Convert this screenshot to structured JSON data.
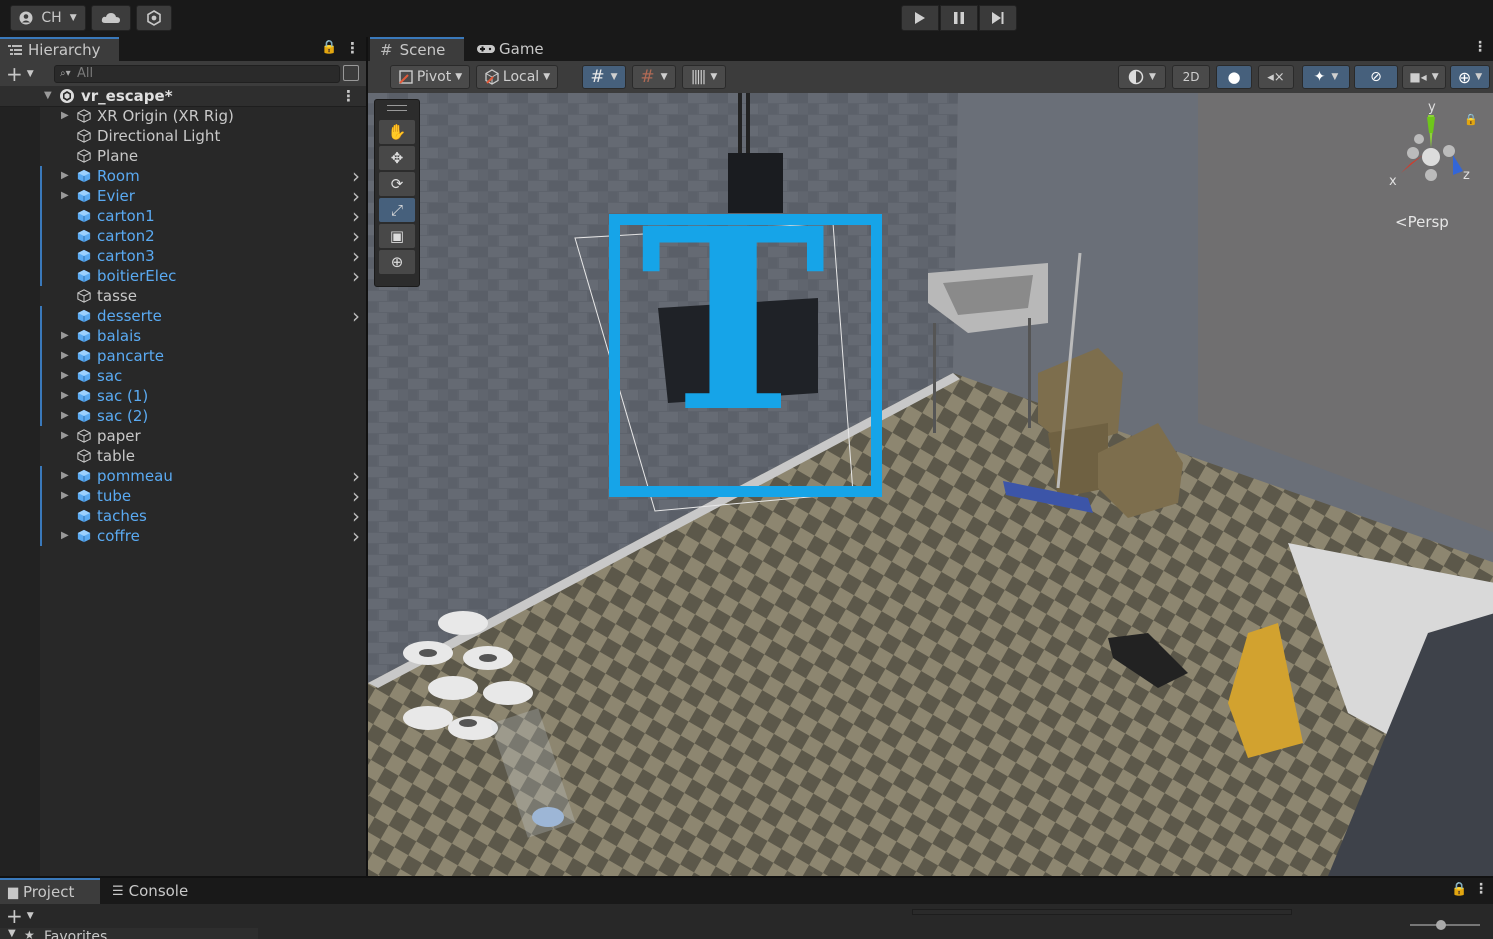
{
  "topbar": {
    "account_label": "CH",
    "icons": [
      "account-icon",
      "cloud-icon",
      "collab-icon"
    ],
    "play_controls": [
      "play-icon",
      "pause-icon",
      "step-icon"
    ]
  },
  "hierarchy": {
    "tab_label": "Hierarchy",
    "search_placeholder": "All",
    "scene_name": "vr_escape*",
    "items": [
      {
        "label": "XR Origin (XR Rig)",
        "prefab": false,
        "expandable": true,
        "chevron": false
      },
      {
        "label": "Directional Light",
        "prefab": false,
        "expandable": false,
        "chevron": false
      },
      {
        "label": "Plane",
        "prefab": false,
        "expandable": false,
        "chevron": false
      },
      {
        "label": "Room",
        "prefab": true,
        "expandable": true,
        "chevron": true
      },
      {
        "label": "Evier",
        "prefab": true,
        "expandable": true,
        "chevron": true
      },
      {
        "label": "carton1",
        "prefab": true,
        "expandable": false,
        "chevron": true
      },
      {
        "label": "carton2",
        "prefab": true,
        "expandable": false,
        "chevron": true
      },
      {
        "label": "carton3",
        "prefab": true,
        "expandable": false,
        "chevron": true
      },
      {
        "label": "boitierElec",
        "prefab": true,
        "expandable": false,
        "chevron": true
      },
      {
        "label": "tasse",
        "prefab": false,
        "expandable": false,
        "chevron": false
      },
      {
        "label": "desserte",
        "prefab": true,
        "expandable": false,
        "chevron": true
      },
      {
        "label": "balais",
        "prefab": true,
        "expandable": true,
        "chevron": false
      },
      {
        "label": "pancarte",
        "prefab": true,
        "expandable": true,
        "chevron": false
      },
      {
        "label": "sac",
        "prefab": true,
        "expandable": true,
        "chevron": false
      },
      {
        "label": "sac (1)",
        "prefab": true,
        "expandable": true,
        "chevron": false
      },
      {
        "label": "sac (2)",
        "prefab": true,
        "expandable": true,
        "chevron": false
      },
      {
        "label": "paper",
        "prefab": false,
        "expandable": true,
        "chevron": false
      },
      {
        "label": "table",
        "prefab": false,
        "expandable": false,
        "chevron": false
      },
      {
        "label": "pommeau",
        "prefab": true,
        "expandable": true,
        "chevron": true
      },
      {
        "label": "tube",
        "prefab": true,
        "expandable": true,
        "chevron": true
      },
      {
        "label": "taches",
        "prefab": true,
        "expandable": false,
        "chevron": true
      },
      {
        "label": "coffre",
        "prefab": true,
        "expandable": true,
        "chevron": true
      }
    ]
  },
  "scene_view": {
    "tabs": [
      {
        "label": "Scene"
      },
      {
        "label": "Game"
      }
    ],
    "pivot_label": "Pivot",
    "local_label": "Local",
    "mode_2d_label": "2D",
    "persp_label": "Persp",
    "gizmo": {
      "y": "y",
      "x": "x",
      "z": "z"
    },
    "selected_icon_glyph": "T"
  },
  "bottom_panel": {
    "tabs": [
      {
        "label": "Project"
      },
      {
        "label": "Console"
      }
    ],
    "favorites_label": "Favorites"
  },
  "colors": {
    "accent_blue": "#3a79bb",
    "prefab_text": "#5aaaf2",
    "panel_bg": "#282828",
    "toolbar_bg": "#3c3c3c",
    "selection_icon": "#16a4e8"
  }
}
